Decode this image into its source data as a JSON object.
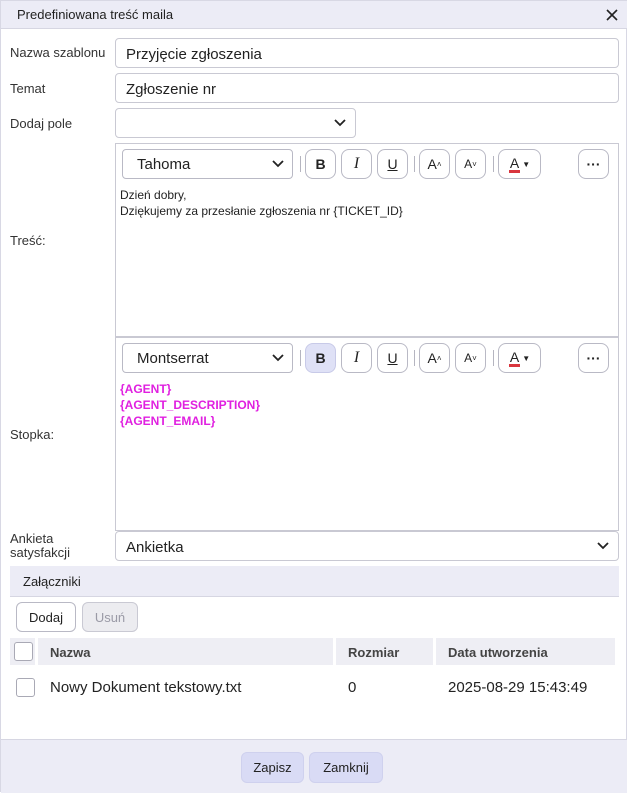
{
  "dialog": {
    "title": "Predefiniowana treść maila",
    "close_icon": "close-icon"
  },
  "form": {
    "template_name_label": "Nazwa szablonu",
    "template_name_value": "Przyjęcie zgłoszenia",
    "subject_label": "Temat",
    "subject_value": "Zgłoszenie nr",
    "add_field_label": "Dodaj pole",
    "add_field_value": "",
    "body_label": "Treść:",
    "footer_label": "Stopka:",
    "survey_label_line1": "Ankieta",
    "survey_label_line2": "satysfakcji",
    "survey_value": "Ankietka"
  },
  "body_editor": {
    "font": "Tahoma",
    "bold_active": false,
    "lines": [
      "Dzień dobry,",
      "Dziękujemy za przesłanie zgłoszenia nr {TICKET_ID}"
    ]
  },
  "footer_editor": {
    "font": "Montserrat",
    "bold_active": true,
    "tag_color": "#e020e0",
    "lines": [
      "{AGENT}",
      "{AGENT_DESCRIPTION}",
      "{AGENT_EMAIL}"
    ]
  },
  "toolbar": {
    "bold": "B",
    "italic": "I",
    "underline": "U",
    "increase_font": "A",
    "decrease_font": "A",
    "font_color": "A",
    "font_color_bar": "#d9363e",
    "more": "···"
  },
  "attachments": {
    "section_title": "Załączniki",
    "add_button": "Dodaj",
    "remove_button": "Usuń",
    "columns": [
      "Nazwa",
      "Rozmiar",
      "Data utworzenia"
    ],
    "rows": [
      {
        "name": "Nowy Dokument tekstowy.txt",
        "size": "0",
        "created": "2025-08-29 15:43:49",
        "checked": false
      }
    ]
  },
  "footer_buttons": {
    "save": "Zapisz",
    "close": "Zamknij"
  },
  "colors": {
    "accent": "#d9dbf5",
    "header_bg": "#ececf6"
  }
}
